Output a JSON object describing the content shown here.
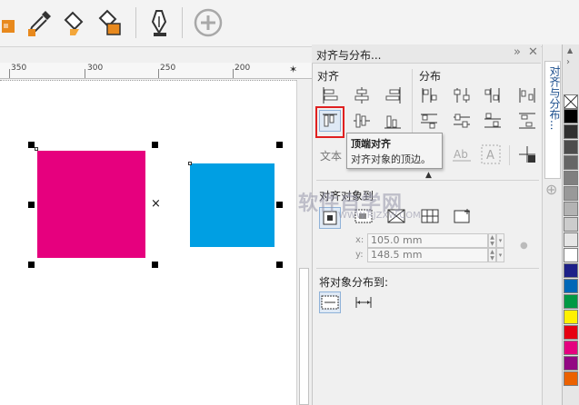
{
  "toolbar": {
    "icons": [
      "fill-bucket-icon",
      "eyedropper-icon",
      "paint-bucket-icon",
      "copy-fill-icon",
      "pen-nib-icon",
      "add-icon"
    ]
  },
  "ruler": {
    "labels": [
      "350",
      "300",
      "250",
      "200"
    ]
  },
  "canvas": {
    "shapes": [
      {
        "name": "magenta-rectangle",
        "color": "#e6007e"
      },
      {
        "name": "cyan-rectangle",
        "color": "#009fe3"
      }
    ]
  },
  "docker": {
    "title": "对齐与分布...",
    "align_label": "对齐",
    "distribute_label": "分布",
    "text_label": "文本",
    "align_to_label": "对齐对象到",
    "x_field": "105.0 mm",
    "y_field": "148.5 mm",
    "x_prefix": "x:",
    "y_prefix": "y:",
    "distribute_to_label": "将对象分布到:"
  },
  "tooltip": {
    "title": "顶端对齐",
    "description": "对齐对象的顶边。"
  },
  "side_tab": {
    "label": "对齐与分布..."
  },
  "palette": {
    "swatches": [
      "#000000",
      "#303030",
      "#4d4d4d",
      "#666666",
      "#808080",
      "#999999",
      "#b3b3b3",
      "#cccccc",
      "#e6e6e6",
      "#ffffff",
      "#1d2088",
      "#0068b7",
      "#009944",
      "#fff100",
      "#e60012",
      "#e4007f",
      "#920783",
      "#eb6100"
    ]
  },
  "watermark": {
    "text": "软件自学网",
    "sub": "WWW.RJZXW.COM"
  }
}
